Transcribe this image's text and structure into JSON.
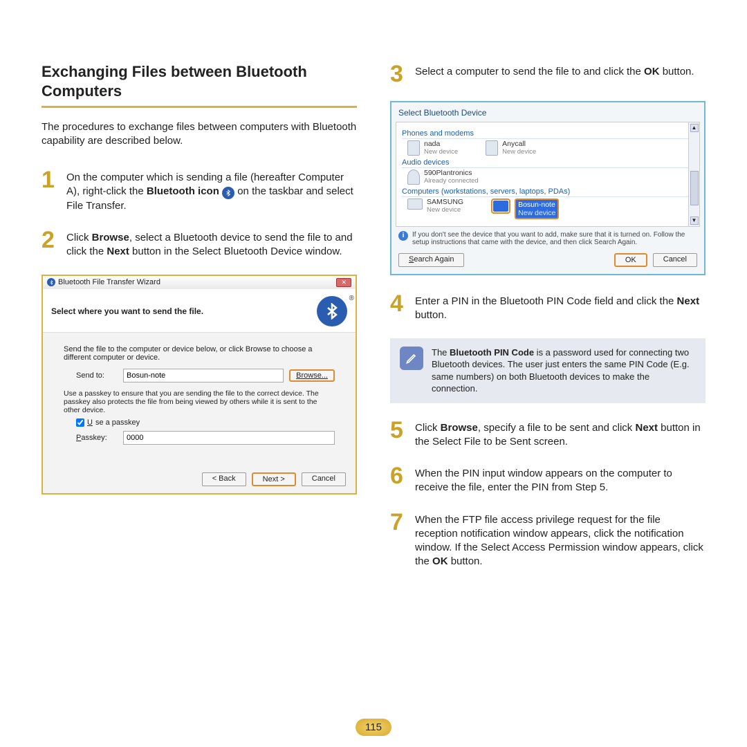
{
  "heading": "Exchanging Files between Bluetooth Computers",
  "intro": "The procedures to exchange files between computers with Bluetooth capability are described below.",
  "steps": {
    "s1a": "On the computer which is sending a file (hereafter Computer A), right-click the ",
    "s1b": "Bluetooth icon",
    "s1c": " on the taskbar and select File Transfer.",
    "s2": "Click Browse, select a Bluetooth device to send the file to and click the Next button in the Select Bluetooth Device window.",
    "s3": "Select a computer to send the file to and click the OK button.",
    "s4": "Enter a PIN in the Bluetooth PIN Code field and click the Next button.",
    "s5": "Click Browse, specify a file to be sent and click Next button in the Select File to be Sent screen.",
    "s6": "When the PIN input window appears on the computer to receive the file, enter the PIN from Step 5.",
    "s7": "When the FTP file access privilege request for the file reception notification window appears, click the notification window. If the Select Access Permission window appears, click the OK button."
  },
  "wizard": {
    "title": "Bluetooth File Transfer Wizard",
    "head": "Select where you want to send the file.",
    "desc": "Send the file to the computer or device below, or click Browse to choose a different computer or device.",
    "send_to_label": "Send to:",
    "send_to_value": "Bosun-note",
    "browse": "Browse...",
    "passkey_note": "Use a passkey to ensure that you are sending the file to the correct device. The passkey also protects the file from being viewed by others while it is sent to the other device.",
    "use_passkey": "Use a passkey",
    "passkey_label": "Passkey:",
    "passkey_value": "0000",
    "back": "< Back",
    "next": "Next >",
    "cancel": "Cancel"
  },
  "select_dialog": {
    "title": "Select Bluetooth Device",
    "sec_phones": "Phones and modems",
    "dev_nada": "nada",
    "dev_anycall": "Anycall",
    "new_device": "New device",
    "sec_audio": "Audio devices",
    "dev_plan": "590Plantronics",
    "already": "Already connected",
    "sec_comp": "Computers (workstations, servers, laptops, PDAs)",
    "dev_samsung": "SAMSUNG",
    "dev_bosun": "Bosun-note",
    "tip": "If you don't see the device that you want to add, make sure that it is turned on. Follow the setup instructions that came with the device, and then click Search Again.",
    "search": "Search Again",
    "ok": "OK",
    "cancel": "Cancel"
  },
  "note": "The Bluetooth PIN Code is a password used for connecting two Bluetooth devices. The user just enters the same PIN Code (E.g. same numbers) on both Bluetooth devices to make the connection.",
  "note_bold": "Bluetooth PIN Code",
  "page_number": "115"
}
